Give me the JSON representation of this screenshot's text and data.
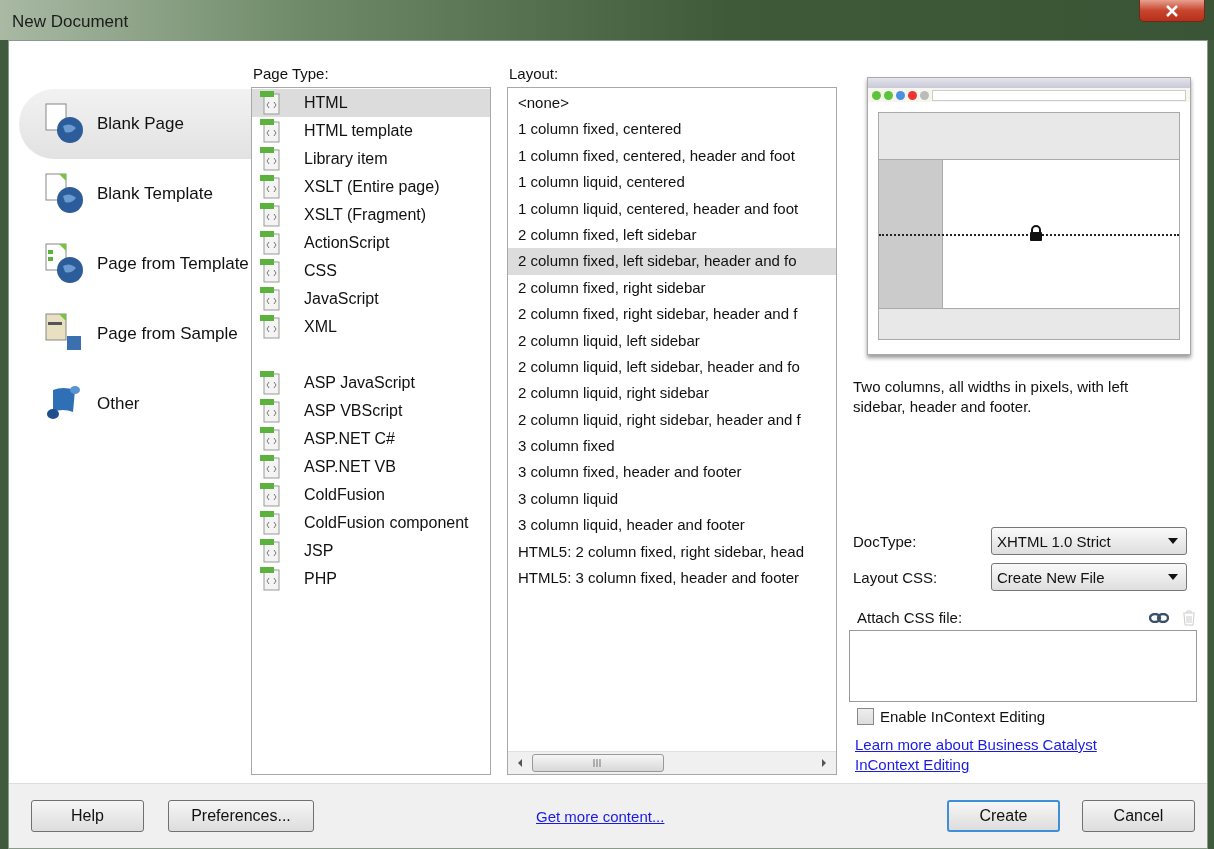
{
  "window": {
    "title": "New Document"
  },
  "categories": [
    {
      "label": "Blank Page",
      "kind": "blank_page",
      "selected": true
    },
    {
      "label": "Blank Template",
      "kind": "blank_template",
      "selected": false
    },
    {
      "label": "Page from Template",
      "kind": "page_from_template",
      "selected": false
    },
    {
      "label": "Page from Sample",
      "kind": "page_from_sample",
      "selected": false
    },
    {
      "label": "Other",
      "kind": "other",
      "selected": false
    }
  ],
  "page_type": {
    "heading": "Page Type:",
    "groups": [
      [
        {
          "label": "HTML",
          "selected": true
        },
        {
          "label": "HTML template",
          "selected": false
        },
        {
          "label": "Library item",
          "selected": false
        },
        {
          "label": "XSLT (Entire page)",
          "selected": false
        },
        {
          "label": "XSLT (Fragment)",
          "selected": false
        },
        {
          "label": "ActionScript",
          "selected": false
        },
        {
          "label": "CSS",
          "selected": false
        },
        {
          "label": "JavaScript",
          "selected": false
        },
        {
          "label": "XML",
          "selected": false
        }
      ],
      [
        {
          "label": "ASP JavaScript",
          "selected": false
        },
        {
          "label": "ASP VBScript",
          "selected": false
        },
        {
          "label": "ASP.NET C#",
          "selected": false
        },
        {
          "label": "ASP.NET VB",
          "selected": false
        },
        {
          "label": "ColdFusion",
          "selected": false
        },
        {
          "label": "ColdFusion component",
          "selected": false
        },
        {
          "label": "JSP",
          "selected": false
        },
        {
          "label": "PHP",
          "selected": false
        }
      ]
    ]
  },
  "layout": {
    "heading": "Layout:",
    "items": [
      {
        "label": "<none>",
        "selected": false
      },
      {
        "label": "1 column fixed, centered",
        "selected": false
      },
      {
        "label": "1 column fixed, centered, header and foot",
        "selected": false
      },
      {
        "label": "1 column liquid, centered",
        "selected": false
      },
      {
        "label": "1 column liquid, centered, header and foot",
        "selected": false
      },
      {
        "label": "2 column fixed, left sidebar",
        "selected": false
      },
      {
        "label": "2 column fixed, left sidebar, header and fo",
        "selected": true
      },
      {
        "label": "2 column fixed, right sidebar",
        "selected": false
      },
      {
        "label": "2 column fixed, right sidebar, header and f",
        "selected": false
      },
      {
        "label": "2 column liquid, left sidebar",
        "selected": false
      },
      {
        "label": "2 column liquid, left sidebar, header and fo",
        "selected": false
      },
      {
        "label": "2 column liquid, right sidebar",
        "selected": false
      },
      {
        "label": "2 column liquid, right sidebar, header and f",
        "selected": false
      },
      {
        "label": "3 column fixed",
        "selected": false
      },
      {
        "label": "3 column fixed, header and footer",
        "selected": false
      },
      {
        "label": "3 column liquid",
        "selected": false
      },
      {
        "label": "3 column liquid, header and footer",
        "selected": false
      },
      {
        "label": "HTML5: 2 column fixed, right sidebar, head",
        "selected": false
      },
      {
        "label": "HTML5: 3 column fixed, header and footer",
        "selected": false
      }
    ]
  },
  "description": "Two columns, all widths in pixels, with left sidebar, header and footer.",
  "doctype": {
    "label": "DocType:",
    "value": "XHTML 1.0 Strict"
  },
  "layout_css": {
    "label": "Layout CSS:",
    "value": "Create New File"
  },
  "attach_css": {
    "label": "Attach CSS file:"
  },
  "incontext": {
    "label": "Enable InContext Editing",
    "checked": false
  },
  "learn_more_link": "Learn more about Business Catalyst InContext Editing",
  "footer": {
    "help": "Help",
    "preferences": "Preferences...",
    "more_content_link": "Get more content...",
    "create": "Create",
    "cancel": "Cancel"
  }
}
